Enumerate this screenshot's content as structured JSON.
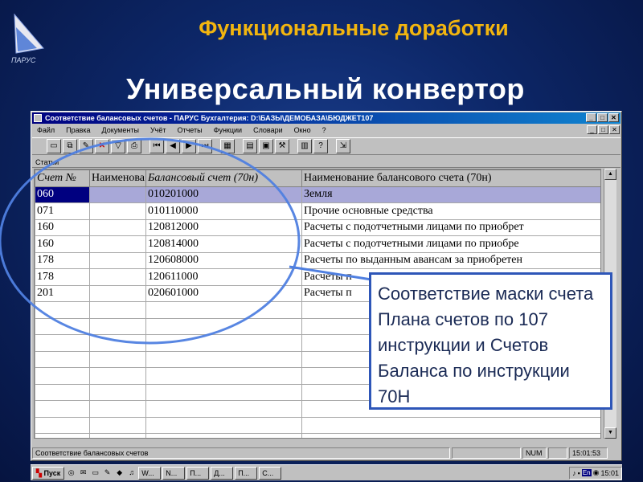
{
  "slide": {
    "subtitle": "Функциональные доработки",
    "title": "Универсальный конвертор",
    "logo_text": "ПАРУС"
  },
  "window": {
    "title": "Соответствие балансовых счетов - ПАРУС Бухгалтерия: D:\\БАЗЫ\\ДЕМОБАЗА\\БЮДЖЕТ107",
    "controls": [
      "_",
      "□",
      "✕"
    ],
    "menu": [
      "Файл",
      "Правка",
      "Документы",
      "Учёт",
      "Отчеты",
      "Функции",
      "Словари",
      "Окно",
      "?"
    ],
    "toolbar_icons": [
      "new-icon",
      "copy-icon",
      "edit-icon",
      "delete-icon",
      "filter-icon",
      "print-icon",
      "first-icon",
      "prev-icon",
      "next-icon",
      "last-icon",
      "grid-icon",
      "calendar-icon",
      "tools-icon",
      "calculator-icon",
      "help-icon",
      "export-icon"
    ],
    "section_label": "Статьи"
  },
  "grid": {
    "columns": [
      "Счет №",
      "Наименова",
      "Балансовый счет (70н)",
      "Наименование балансового счета (70н)"
    ],
    "rows": [
      [
        "060",
        "",
        "010201000",
        "Земля"
      ],
      [
        "071",
        "",
        "010110000",
        "Прочие основные средства"
      ],
      [
        "160",
        "",
        "120812000",
        "Расчеты с подотчетными лицами по приобрет"
      ],
      [
        "160",
        "",
        "120814000",
        "Расчеты с подотчетными лицами по приобре"
      ],
      [
        "178",
        "",
        "120608000",
        "Расчеты по выданным авансам за приобретен"
      ],
      [
        "178",
        "",
        "120611000",
        "Расчеты п"
      ],
      [
        "201",
        "",
        "020601000",
        "Расчеты п"
      ]
    ],
    "empty_rows": 9
  },
  "status": {
    "text": "Соответствие балансовых счетов",
    "num": "NUM",
    "time": "15:01:53"
  },
  "taskbar": {
    "start": "Пуск",
    "tasks": [
      "W...",
      "N...",
      "П...",
      "Д...",
      "П...",
      "С..."
    ],
    "lang": "En",
    "time": "15:01"
  },
  "callout": {
    "text": "Соответствие маски счета Плана счетов по 107 инструкции и Счетов Баланса по инструкции 70Н"
  },
  "colors": {
    "background": "#0d2768",
    "subtitle": "#f2b50f",
    "highlight_ring": "#4f7fe0",
    "callout_border": "#2e56b8"
  }
}
